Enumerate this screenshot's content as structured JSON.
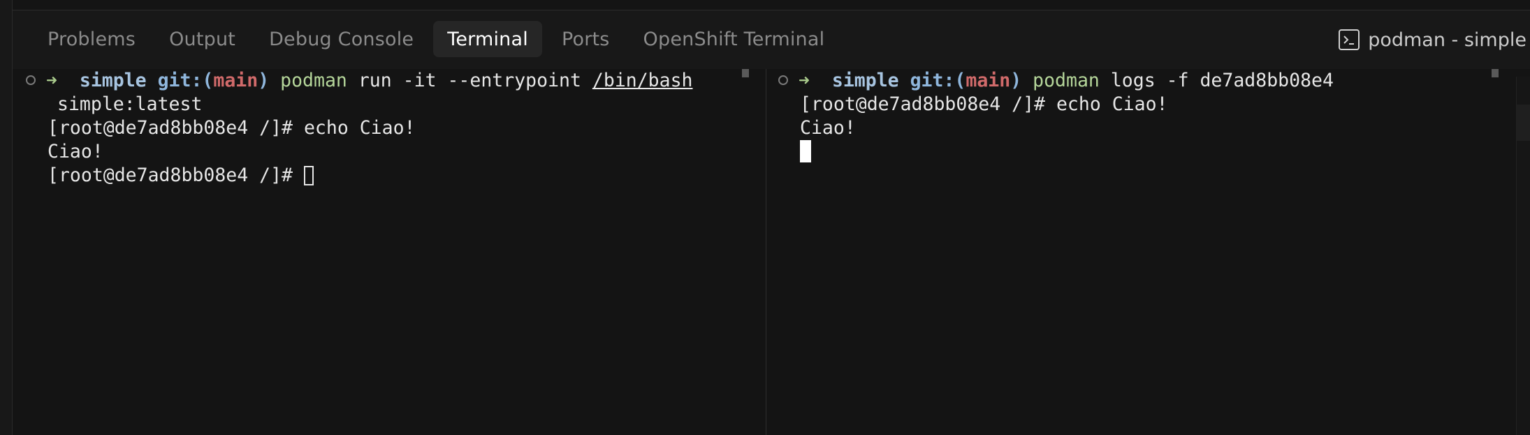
{
  "tabs": [
    {
      "label": "Problems",
      "active": false
    },
    {
      "label": "Output",
      "active": false
    },
    {
      "label": "Debug Console",
      "active": false
    },
    {
      "label": "Terminal",
      "active": true
    },
    {
      "label": "Ports",
      "active": false
    },
    {
      "label": "OpenShift Terminal",
      "active": false
    }
  ],
  "terminal_select": {
    "icon": "terminal-icon",
    "label": "podman - simple"
  },
  "left_pane": {
    "prompt": {
      "arrow": "➜",
      "dir": "simple",
      "git_prefix": "git:(",
      "branch": "main",
      "git_suffix": ")",
      "command": "podman",
      "args_1": "run -it --entrypoint",
      "path": "/bin/bash",
      "args_2": "simple:latest"
    },
    "lines": [
      "[root@de7ad8bb08e4 /]# echo Ciao!",
      "Ciao!",
      "[root@de7ad8bb08e4 /]# "
    ]
  },
  "right_pane": {
    "prompt": {
      "arrow": "➜",
      "dir": "simple",
      "git_prefix": "git:(",
      "branch": "main",
      "git_suffix": ")",
      "command": "podman",
      "args": "logs -f de7ad8bb08e4"
    },
    "lines": [
      "[root@de7ad8bb08e4 /]# echo Ciao!",
      "Ciao!"
    ]
  },
  "colors": {
    "background": "#141414",
    "tabbar": "#181818",
    "active_tab": "#262626",
    "prompt_arrow": "#a8c98b",
    "dir": "#a7c4e0",
    "branch": "#d06a6a",
    "command": "#b5d69a"
  }
}
